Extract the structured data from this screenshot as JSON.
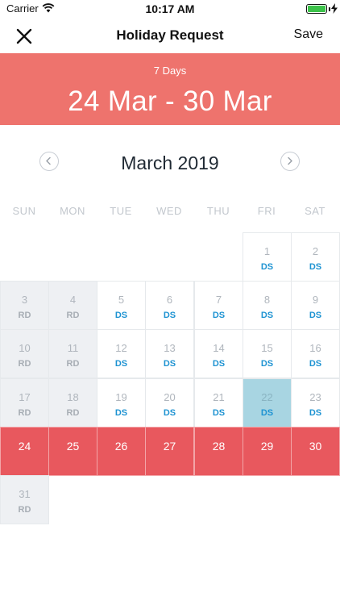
{
  "status_bar": {
    "carrier": "Carrier",
    "time": "10:17 AM",
    "battery_color": "#3cc24a"
  },
  "nav": {
    "title": "Holiday Request",
    "save_label": "Save",
    "close_icon": "close-icon"
  },
  "banner": {
    "days_label": "7 Days",
    "date_range": "24 Mar - 30 Mar",
    "color": "#ee736d"
  },
  "calendar": {
    "month_label": "March 2019",
    "prev_icon": "chevron-left-icon",
    "next_icon": "chevron-right-icon",
    "weekdays": [
      "SUN",
      "MON",
      "TUE",
      "WED",
      "THU",
      "FRI",
      "SAT"
    ],
    "selected_color": "#e8585e",
    "today_color": "#a8d5e2",
    "days": [
      {
        "day": "1",
        "code": "DS",
        "type": "ds"
      },
      {
        "day": "2",
        "code": "DS",
        "type": "ds"
      },
      {
        "day": "3",
        "code": "RD",
        "type": "rd"
      },
      {
        "day": "4",
        "code": "RD",
        "type": "rd"
      },
      {
        "day": "5",
        "code": "DS",
        "type": "ds"
      },
      {
        "day": "6",
        "code": "DS",
        "type": "ds"
      },
      {
        "day": "7",
        "code": "DS",
        "type": "ds"
      },
      {
        "day": "8",
        "code": "DS",
        "type": "ds"
      },
      {
        "day": "9",
        "code": "DS",
        "type": "ds"
      },
      {
        "day": "10",
        "code": "RD",
        "type": "rd"
      },
      {
        "day": "11",
        "code": "RD",
        "type": "rd"
      },
      {
        "day": "12",
        "code": "DS",
        "type": "ds"
      },
      {
        "day": "13",
        "code": "DS",
        "type": "ds"
      },
      {
        "day": "14",
        "code": "DS",
        "type": "ds"
      },
      {
        "day": "15",
        "code": "DS",
        "type": "ds"
      },
      {
        "day": "16",
        "code": "DS",
        "type": "ds"
      },
      {
        "day": "17",
        "code": "RD",
        "type": "rd"
      },
      {
        "day": "18",
        "code": "RD",
        "type": "rd"
      },
      {
        "day": "19",
        "code": "DS",
        "type": "ds"
      },
      {
        "day": "20",
        "code": "DS",
        "type": "ds"
      },
      {
        "day": "21",
        "code": "DS",
        "type": "ds"
      },
      {
        "day": "22",
        "code": "DS",
        "type": "today"
      },
      {
        "day": "23",
        "code": "DS",
        "type": "ds"
      },
      {
        "day": "24",
        "code": "",
        "type": "selected"
      },
      {
        "day": "25",
        "code": "",
        "type": "selected"
      },
      {
        "day": "26",
        "code": "",
        "type": "selected"
      },
      {
        "day": "27",
        "code": "",
        "type": "selected"
      },
      {
        "day": "28",
        "code": "",
        "type": "selected"
      },
      {
        "day": "29",
        "code": "",
        "type": "selected"
      },
      {
        "day": "30",
        "code": "",
        "type": "selected"
      },
      {
        "day": "31",
        "code": "RD",
        "type": "rd"
      }
    ]
  }
}
